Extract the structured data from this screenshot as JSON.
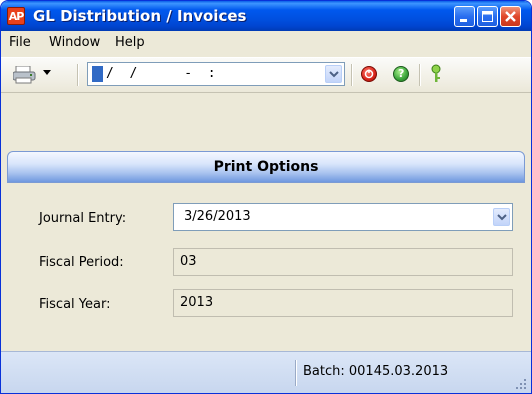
{
  "window": {
    "title": "GL Distribution / Invoices",
    "app_icon_text": "AP"
  },
  "menu": {
    "items": [
      {
        "label": "File"
      },
      {
        "label": "Window"
      },
      {
        "label": "Help"
      }
    ]
  },
  "toolbar": {
    "date_field_value": "/  /      -  :",
    "icons": [
      "printer-icon",
      "chevron-down-icon",
      "stop-icon",
      "help-icon",
      "key-icon"
    ]
  },
  "section": {
    "title": "Print Options"
  },
  "form": {
    "journal_entry_label": "Journal Entry:",
    "journal_entry_value": "3/26/2013",
    "fiscal_period_label": "Fiscal Period:",
    "fiscal_period_value": "03",
    "fiscal_year_label": "Fiscal Year:",
    "fiscal_year_value": "2013"
  },
  "status": {
    "batch_text": "Batch: 00145.03.2013"
  },
  "colors": {
    "titlebar": "#0058ee",
    "accent_red": "#d9241a",
    "accent_green": "#3aa43a"
  }
}
